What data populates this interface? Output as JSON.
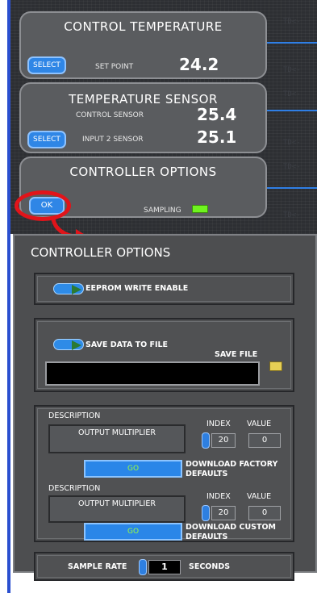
{
  "control_temperature": {
    "title": "CONTROL  TEMPERATURE",
    "select_label": "SELECT",
    "set_point_label": "SET POINT",
    "set_point_value": "24.2"
  },
  "temperature_sensor": {
    "title": "TEMPERATURE SENSOR",
    "control_sensor_label": "CONTROL SENSOR",
    "control_sensor_value": "25.4",
    "select_label": "SELECT",
    "input2_label": "INPUT 2 SENSOR",
    "input2_value": "25.1"
  },
  "controller_options_card": {
    "title": "CONTROLLER OPTIONS",
    "ok_label": "OK",
    "sampling_label": "SAMPLING"
  },
  "options_panel": {
    "title": "CONTROLLER OPTIONS",
    "eeprom_label": "EEPROM WRITE ENABLE",
    "save_data_label": "SAVE DATA TO FILE",
    "save_file_label": "SAVE FILE",
    "file_path_value": "",
    "factory": {
      "description_label": "DESCRIPTION",
      "description_value": "OUTPUT MULTIPLIER",
      "index_label": "INDEX",
      "index_value": "20",
      "value_label": "VALUE",
      "value_value": "0",
      "go_label": "GO",
      "download_label": "DOWNLOAD FACTORY DEFAULTS"
    },
    "custom": {
      "description_label": "DESCRIPTION",
      "description_value": "OUTPUT MULTIPLIER",
      "index_label": "INDEX",
      "index_value": "20",
      "value_label": "VALUE",
      "value_value": "0",
      "go_label": "GO",
      "download_label": "DOWNLOAD CUSTOM DEFAULTS"
    },
    "sample_rate_label": "SAMPLE RATE",
    "sample_rate_value": "1",
    "sample_rate_unit": "SECONDS"
  },
  "colors": {
    "accent_blue": "#2f86e6",
    "highlight_red": "#e1141a",
    "led_green": "#6ff31f",
    "go_text": "#9cff3c"
  }
}
